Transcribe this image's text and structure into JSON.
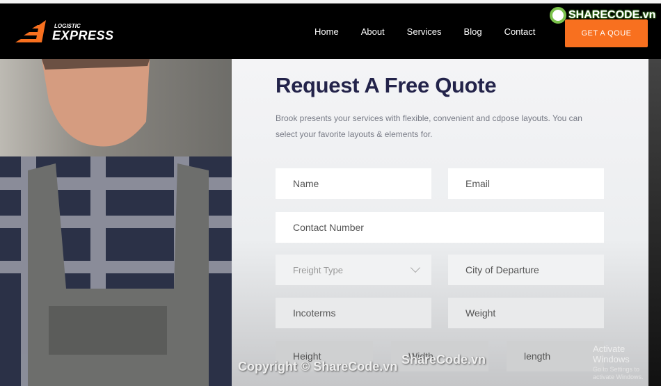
{
  "header": {
    "logo_top": "LOGISTIC",
    "logo_main": "EXPRESS",
    "nav": [
      "Home",
      "About",
      "Services",
      "Blog",
      "Contact"
    ],
    "cta": "GET A QOUE",
    "accent": "#f8701f"
  },
  "watermark": {
    "logo": "SHARECODE.vn",
    "copyright": "Copyright © ShareCode.vn",
    "center": "ShareCode.vn"
  },
  "form": {
    "title": "Request A Free Quote",
    "description": "Brook presents your services with flexible, convenient and cdpose layouts. You can select your favorite layouts & elements for.",
    "name": "Name",
    "email": "Email",
    "contact": "Contact Number",
    "freight": "Freight Type",
    "city": "City of Departure",
    "incoterms": "Incoterms",
    "weight": "Weight",
    "height": "Height",
    "width": "Width",
    "length": "length"
  },
  "os": {
    "activate": "Activate Windows",
    "settings": "Go to Settings to activate Windows."
  }
}
